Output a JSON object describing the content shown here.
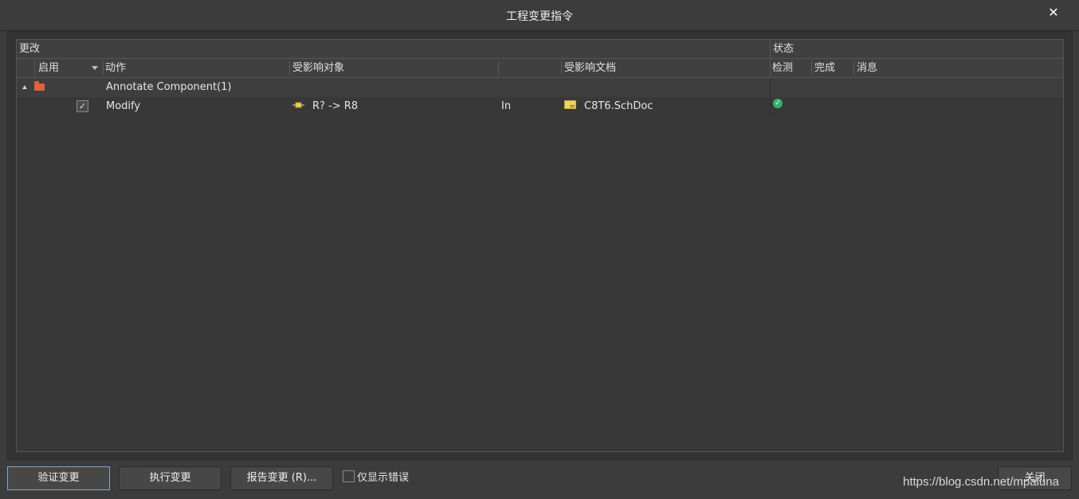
{
  "window": {
    "title": "工程变更指令",
    "close_label": "✕"
  },
  "columns": {
    "group_changes": "更改",
    "group_status": "状态",
    "enable": "启用",
    "action": "动作",
    "affected_object": "受影响对象",
    "affected_document": "受影响文档",
    "check": "检测",
    "done": "完成",
    "message": "消息"
  },
  "rows": [
    {
      "type": "group",
      "expanded": true,
      "icon": "folder-icon",
      "action": "Annotate Component(1)"
    },
    {
      "type": "item",
      "enabled": true,
      "check_mark": "✓",
      "action": "Modify",
      "object_icon": "component-icon",
      "affected_object": "R? -> R8",
      "direction": "In",
      "document_icon": "schematic-doc-icon",
      "affected_document": "C8T6.SchDoc",
      "check_status": "ok",
      "check_glyph": "✓",
      "check_color": "#2fb36b"
    }
  ],
  "footer": {
    "validate_button": "验证变更",
    "execute_button": "执行变更",
    "report_button": "报告变更 (R)...",
    "only_errors_label": "仅显示错误",
    "only_errors_checked": false,
    "close_button": "关闭"
  },
  "watermark": "https://blog.csdn.net/mpaluna"
}
